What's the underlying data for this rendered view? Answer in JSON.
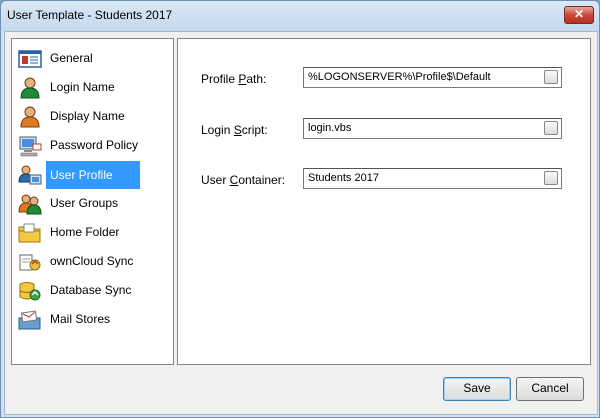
{
  "window": {
    "title": "User Template - Students 2017",
    "close_label": "✕"
  },
  "sidebar": {
    "items": [
      {
        "label": "General",
        "icon": "general-card-icon",
        "selected": false
      },
      {
        "label": "Login Name",
        "icon": "user-icon",
        "selected": false
      },
      {
        "label": "Display Name",
        "icon": "user-icon",
        "selected": false
      },
      {
        "label": "Password Policy",
        "icon": "computer-password-icon",
        "selected": false
      },
      {
        "label": "User Profile",
        "icon": "user-profile-icon",
        "selected": true
      },
      {
        "label": "User Groups",
        "icon": "user-group-icon",
        "selected": false
      },
      {
        "label": "Home Folder",
        "icon": "folder-icon",
        "selected": false
      },
      {
        "label": "ownCloud Sync",
        "icon": "cloud-sync-icon",
        "selected": false
      },
      {
        "label": "Database Sync",
        "icon": "database-sync-icon",
        "selected": false
      },
      {
        "label": "Mail Stores",
        "icon": "mail-store-icon",
        "selected": false
      }
    ]
  },
  "form": {
    "profile_path": {
      "label_pre": "Profile ",
      "label_key": "P",
      "label_post": "ath:",
      "value": "%LOGONSERVER%\\Profile$\\Default"
    },
    "login_script": {
      "label_pre": "Login ",
      "label_key": "S",
      "label_post": "cript:",
      "value": "login.vbs"
    },
    "user_container": {
      "label_pre": "User ",
      "label_key": "C",
      "label_post": "ontainer:",
      "value": "Students 2017"
    }
  },
  "buttons": {
    "save": "Save",
    "cancel": "Cancel"
  },
  "colors": {
    "selection": "#3399ff",
    "close": "#c9483a"
  }
}
